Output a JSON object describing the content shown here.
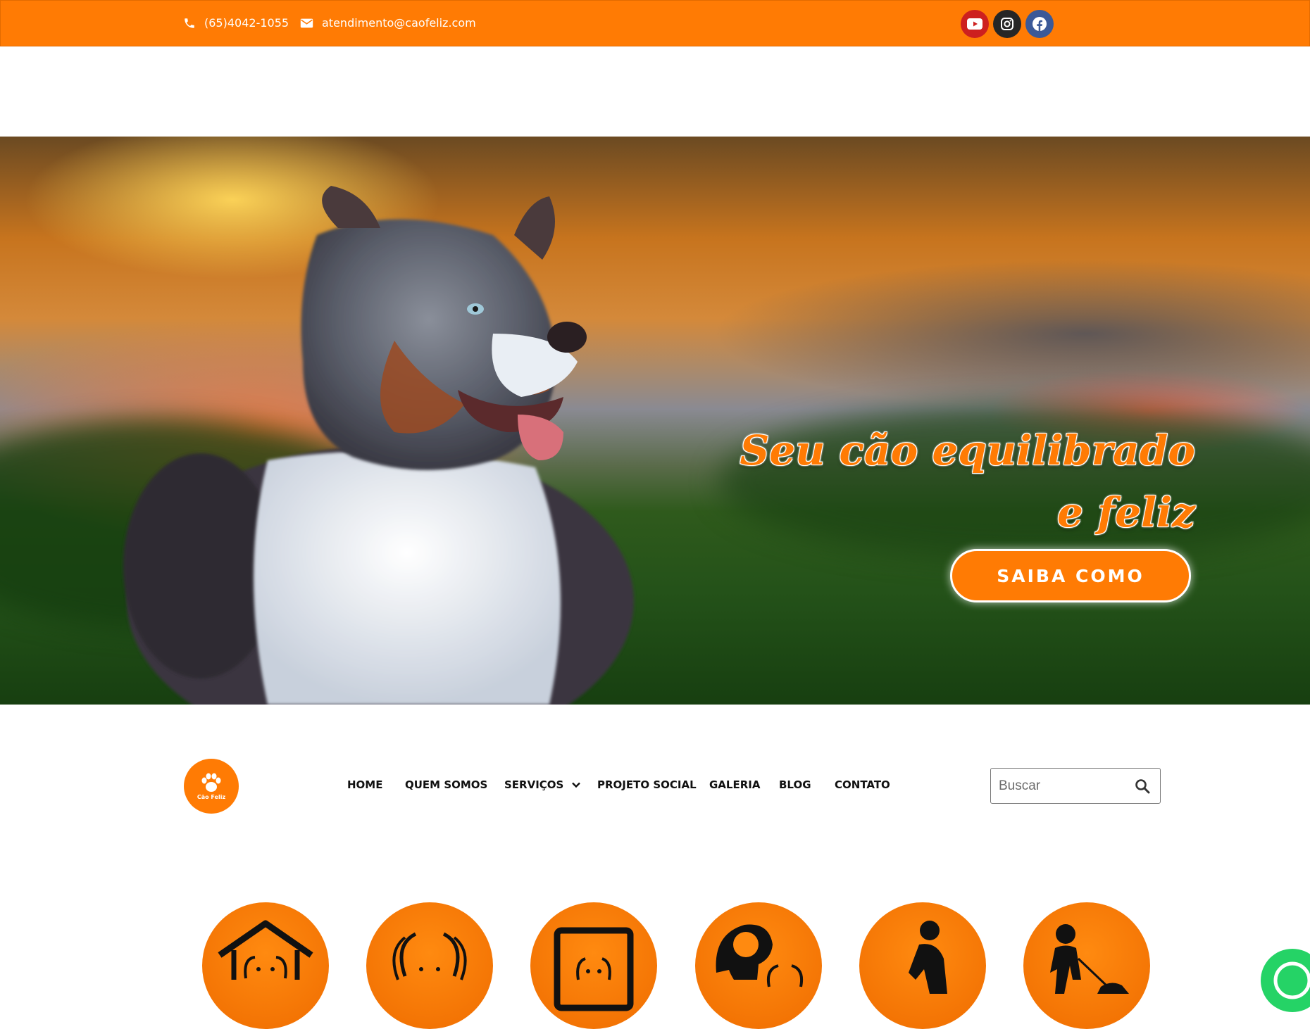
{
  "topbar": {
    "phone": "(65)4042-1055",
    "email": "atendimento@caofeliz.com",
    "social": [
      {
        "name": "youtube",
        "color": "#cd201f"
      },
      {
        "name": "instagram",
        "color": "#262626"
      },
      {
        "name": "facebook",
        "color": "#3b5998"
      }
    ]
  },
  "hero": {
    "title_line1": "Seu cão equilibrado",
    "title_line2": "e feliz",
    "cta_label": "SAIBA COMO"
  },
  "logo": {
    "text": "Cão Feliz"
  },
  "nav": {
    "items": [
      "HOME",
      "QUEM SOMOS",
      "SERVIÇOS",
      "PROJETO SOCIAL",
      "GALERIA",
      "BLOG",
      "CONTATO"
    ]
  },
  "search": {
    "placeholder": "Buscar"
  },
  "features": {
    "icons": [
      "house-dog-icon",
      "dog-face-icon",
      "dog-frame-icon",
      "idea-dog-icon",
      "person-icon",
      "dog-walk-icon"
    ]
  },
  "colors": {
    "accent": "#ff7b04"
  }
}
